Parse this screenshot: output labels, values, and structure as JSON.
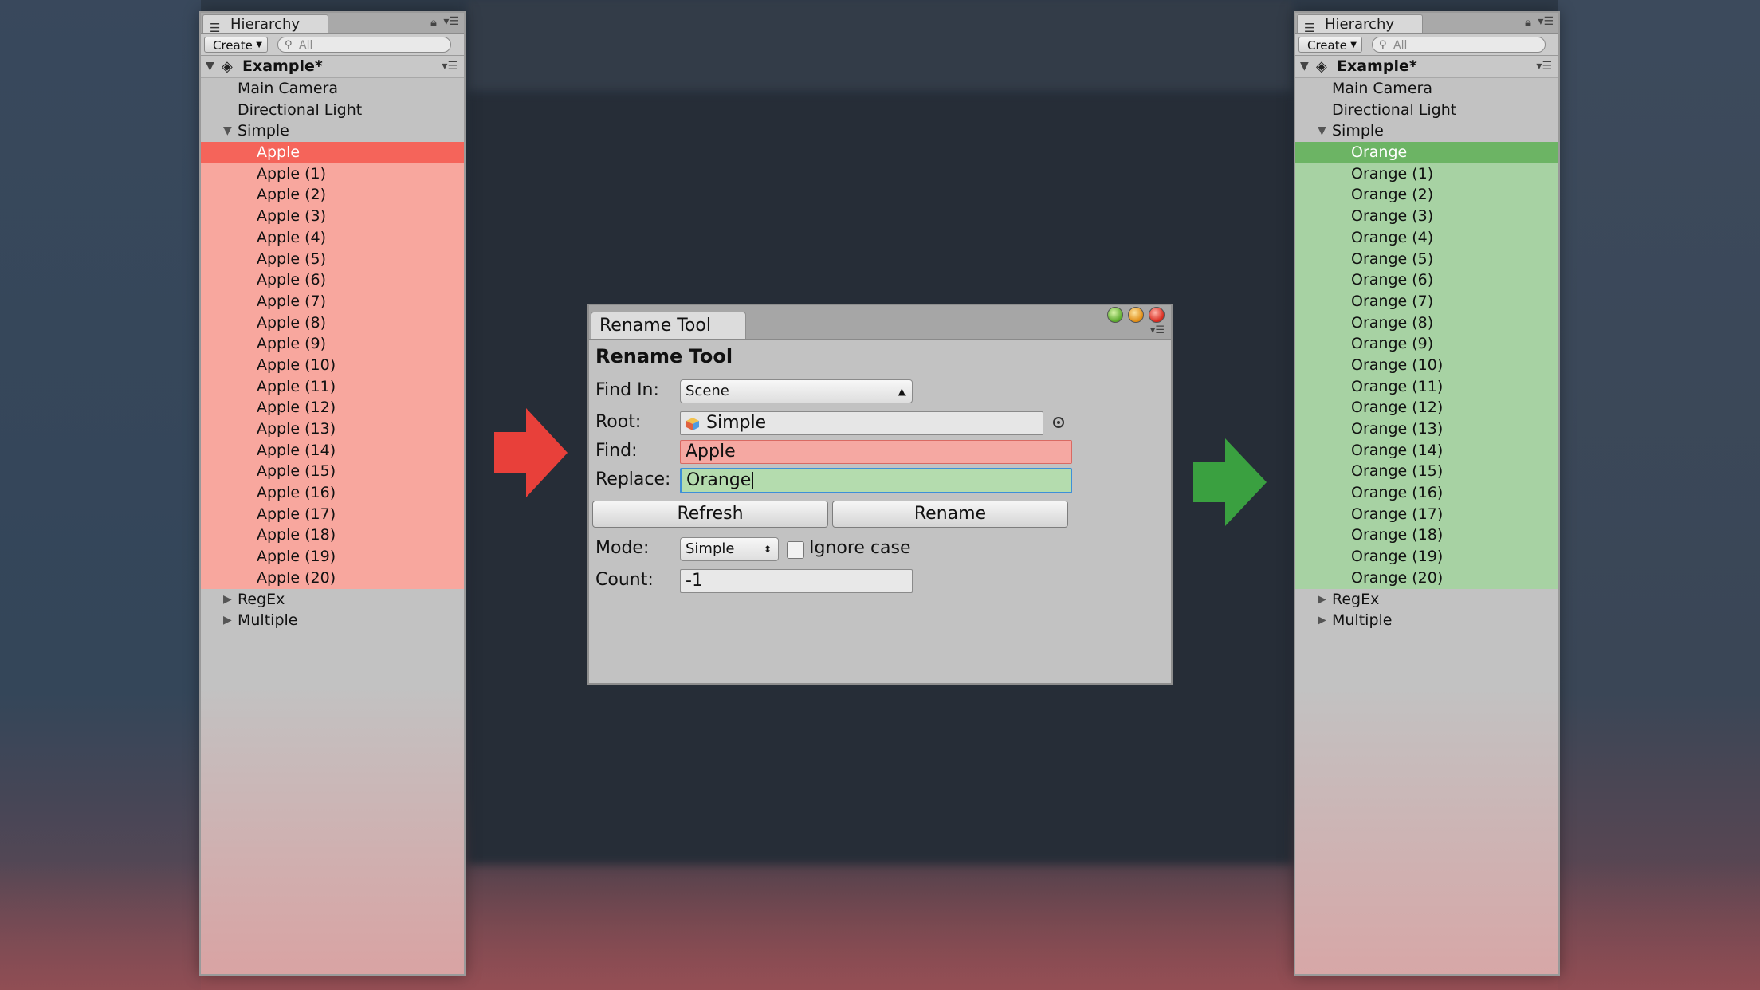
{
  "left_panel": {
    "tab_title": "Hierarchy",
    "create_label": "Create",
    "search_placeholder": "All",
    "scene_name": "Example*",
    "items": [
      "Main Camera",
      "Directional Light"
    ],
    "group_name": "Simple",
    "children": [
      "Apple",
      "Apple (1)",
      "Apple (2)",
      "Apple (3)",
      "Apple (4)",
      "Apple (5)",
      "Apple (6)",
      "Apple (7)",
      "Apple (8)",
      "Apple (9)",
      "Apple (10)",
      "Apple (11)",
      "Apple (12)",
      "Apple (13)",
      "Apple (14)",
      "Apple (15)",
      "Apple (16)",
      "Apple (17)",
      "Apple (18)",
      "Apple (19)",
      "Apple (20)"
    ],
    "collapsed_groups": [
      "RegEx",
      "Multiple"
    ],
    "highlight_color": "#f8a79e",
    "selected_color": "#f5645a"
  },
  "right_panel": {
    "tab_title": "Hierarchy",
    "create_label": "Create",
    "search_placeholder": "All",
    "scene_name": "Example*",
    "items": [
      "Main Camera",
      "Directional Light"
    ],
    "group_name": "Simple",
    "children": [
      "Orange",
      "Orange (1)",
      "Orange (2)",
      "Orange (3)",
      "Orange (4)",
      "Orange (5)",
      "Orange (6)",
      "Orange (7)",
      "Orange (8)",
      "Orange (9)",
      "Orange (10)",
      "Orange (11)",
      "Orange (12)",
      "Orange (13)",
      "Orange (14)",
      "Orange (15)",
      "Orange (16)",
      "Orange (17)",
      "Orange (18)",
      "Orange (19)",
      "Orange (20)"
    ],
    "collapsed_groups": [
      "RegEx",
      "Multiple"
    ],
    "highlight_color": "#a7d2a3",
    "selected_color": "#6cb464"
  },
  "rename_tool": {
    "tab_title": "Rename Tool",
    "heading": "Rename Tool",
    "find_in_label": "Find In:",
    "find_in_value": "Scene",
    "root_label": "Root:",
    "root_value": "Simple",
    "find_label": "Find:",
    "find_value": "Apple",
    "replace_label": "Replace:",
    "replace_value": "Orange",
    "refresh_label": "Refresh",
    "rename_label": "Rename",
    "mode_label": "Mode:",
    "mode_value": "Simple",
    "ignore_case_label": "Ignore case",
    "ignore_case_checked": false,
    "count_label": "Count:",
    "count_value": "-1"
  },
  "arrows": {
    "left_color": "#e8403a",
    "right_color": "#3aa040"
  }
}
